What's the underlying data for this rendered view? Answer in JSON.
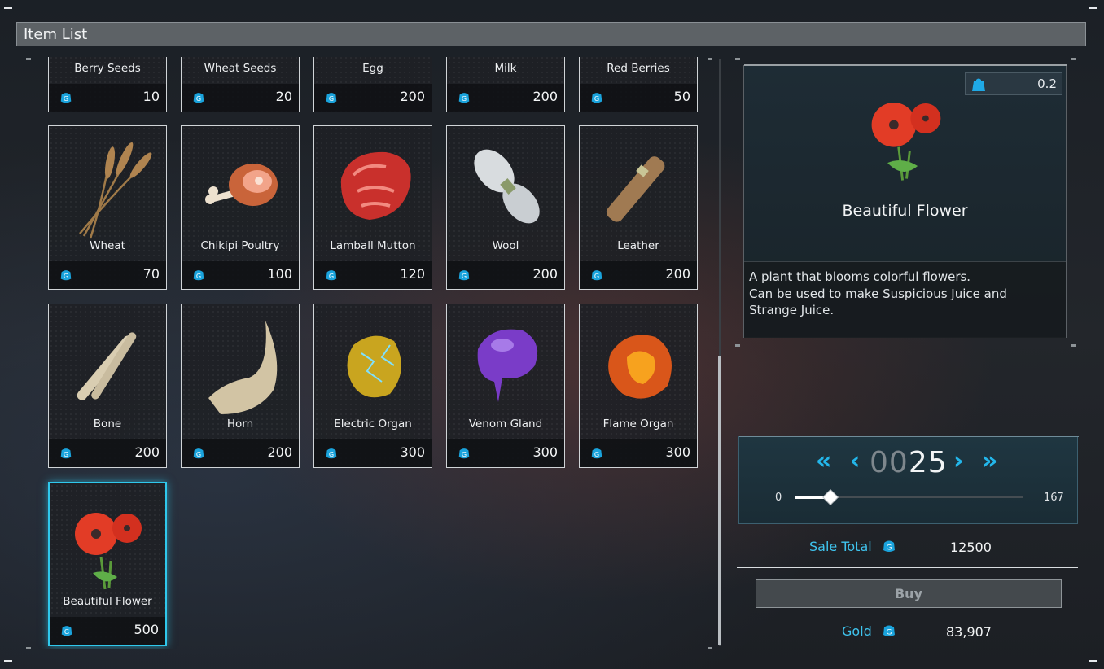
{
  "window": {
    "title": "Item List"
  },
  "items": [
    {
      "name": "Berry Seeds",
      "price": "10",
      "icon": "berry-seeds-icon"
    },
    {
      "name": "Wheat Seeds",
      "price": "20",
      "icon": "wheat-seeds-icon"
    },
    {
      "name": "Egg",
      "price": "200",
      "icon": "egg-icon"
    },
    {
      "name": "Milk",
      "price": "200",
      "icon": "milk-icon"
    },
    {
      "name": "Red Berries",
      "price": "50",
      "icon": "red-berries-icon"
    },
    {
      "name": "Wheat",
      "price": "70",
      "icon": "wheat-icon"
    },
    {
      "name": "Chikipi Poultry",
      "price": "100",
      "icon": "poultry-icon"
    },
    {
      "name": "Lamball Mutton",
      "price": "120",
      "icon": "mutton-icon"
    },
    {
      "name": "Wool",
      "price": "200",
      "icon": "wool-icon"
    },
    {
      "name": "Leather",
      "price": "200",
      "icon": "leather-icon"
    },
    {
      "name": "Bone",
      "price": "200",
      "icon": "bone-icon"
    },
    {
      "name": "Horn",
      "price": "200",
      "icon": "horn-icon"
    },
    {
      "name": "Electric Organ",
      "price": "300",
      "icon": "electric-organ-icon"
    },
    {
      "name": "Venom Gland",
      "price": "300",
      "icon": "venom-gland-icon"
    },
    {
      "name": "Flame Organ",
      "price": "300",
      "icon": "flame-organ-icon"
    },
    {
      "name": "Beautiful Flower",
      "price": "500",
      "icon": "flower-icon",
      "selected": true
    }
  ],
  "detail": {
    "weight": "0.2",
    "name": "Beautiful Flower",
    "description_lines": [
      "A plant that blooms colorful flowers.",
      "Can be used to make Suspicious Juice and",
      "Strange Juice."
    ]
  },
  "quantity": {
    "dim_digits": "00",
    "bright_digits": "25",
    "value": 25,
    "min": "0",
    "max": "167",
    "first_label": "«",
    "prev_label": "‹",
    "next_label": "›",
    "last_label": "»"
  },
  "sale": {
    "label": "Sale Total",
    "value": "12500"
  },
  "buy_label": "Buy",
  "gold": {
    "label": "Gold",
    "value": "83,907"
  },
  "colors": {
    "accent": "#2fc8ec",
    "label_blue": "#3fc4ee"
  }
}
